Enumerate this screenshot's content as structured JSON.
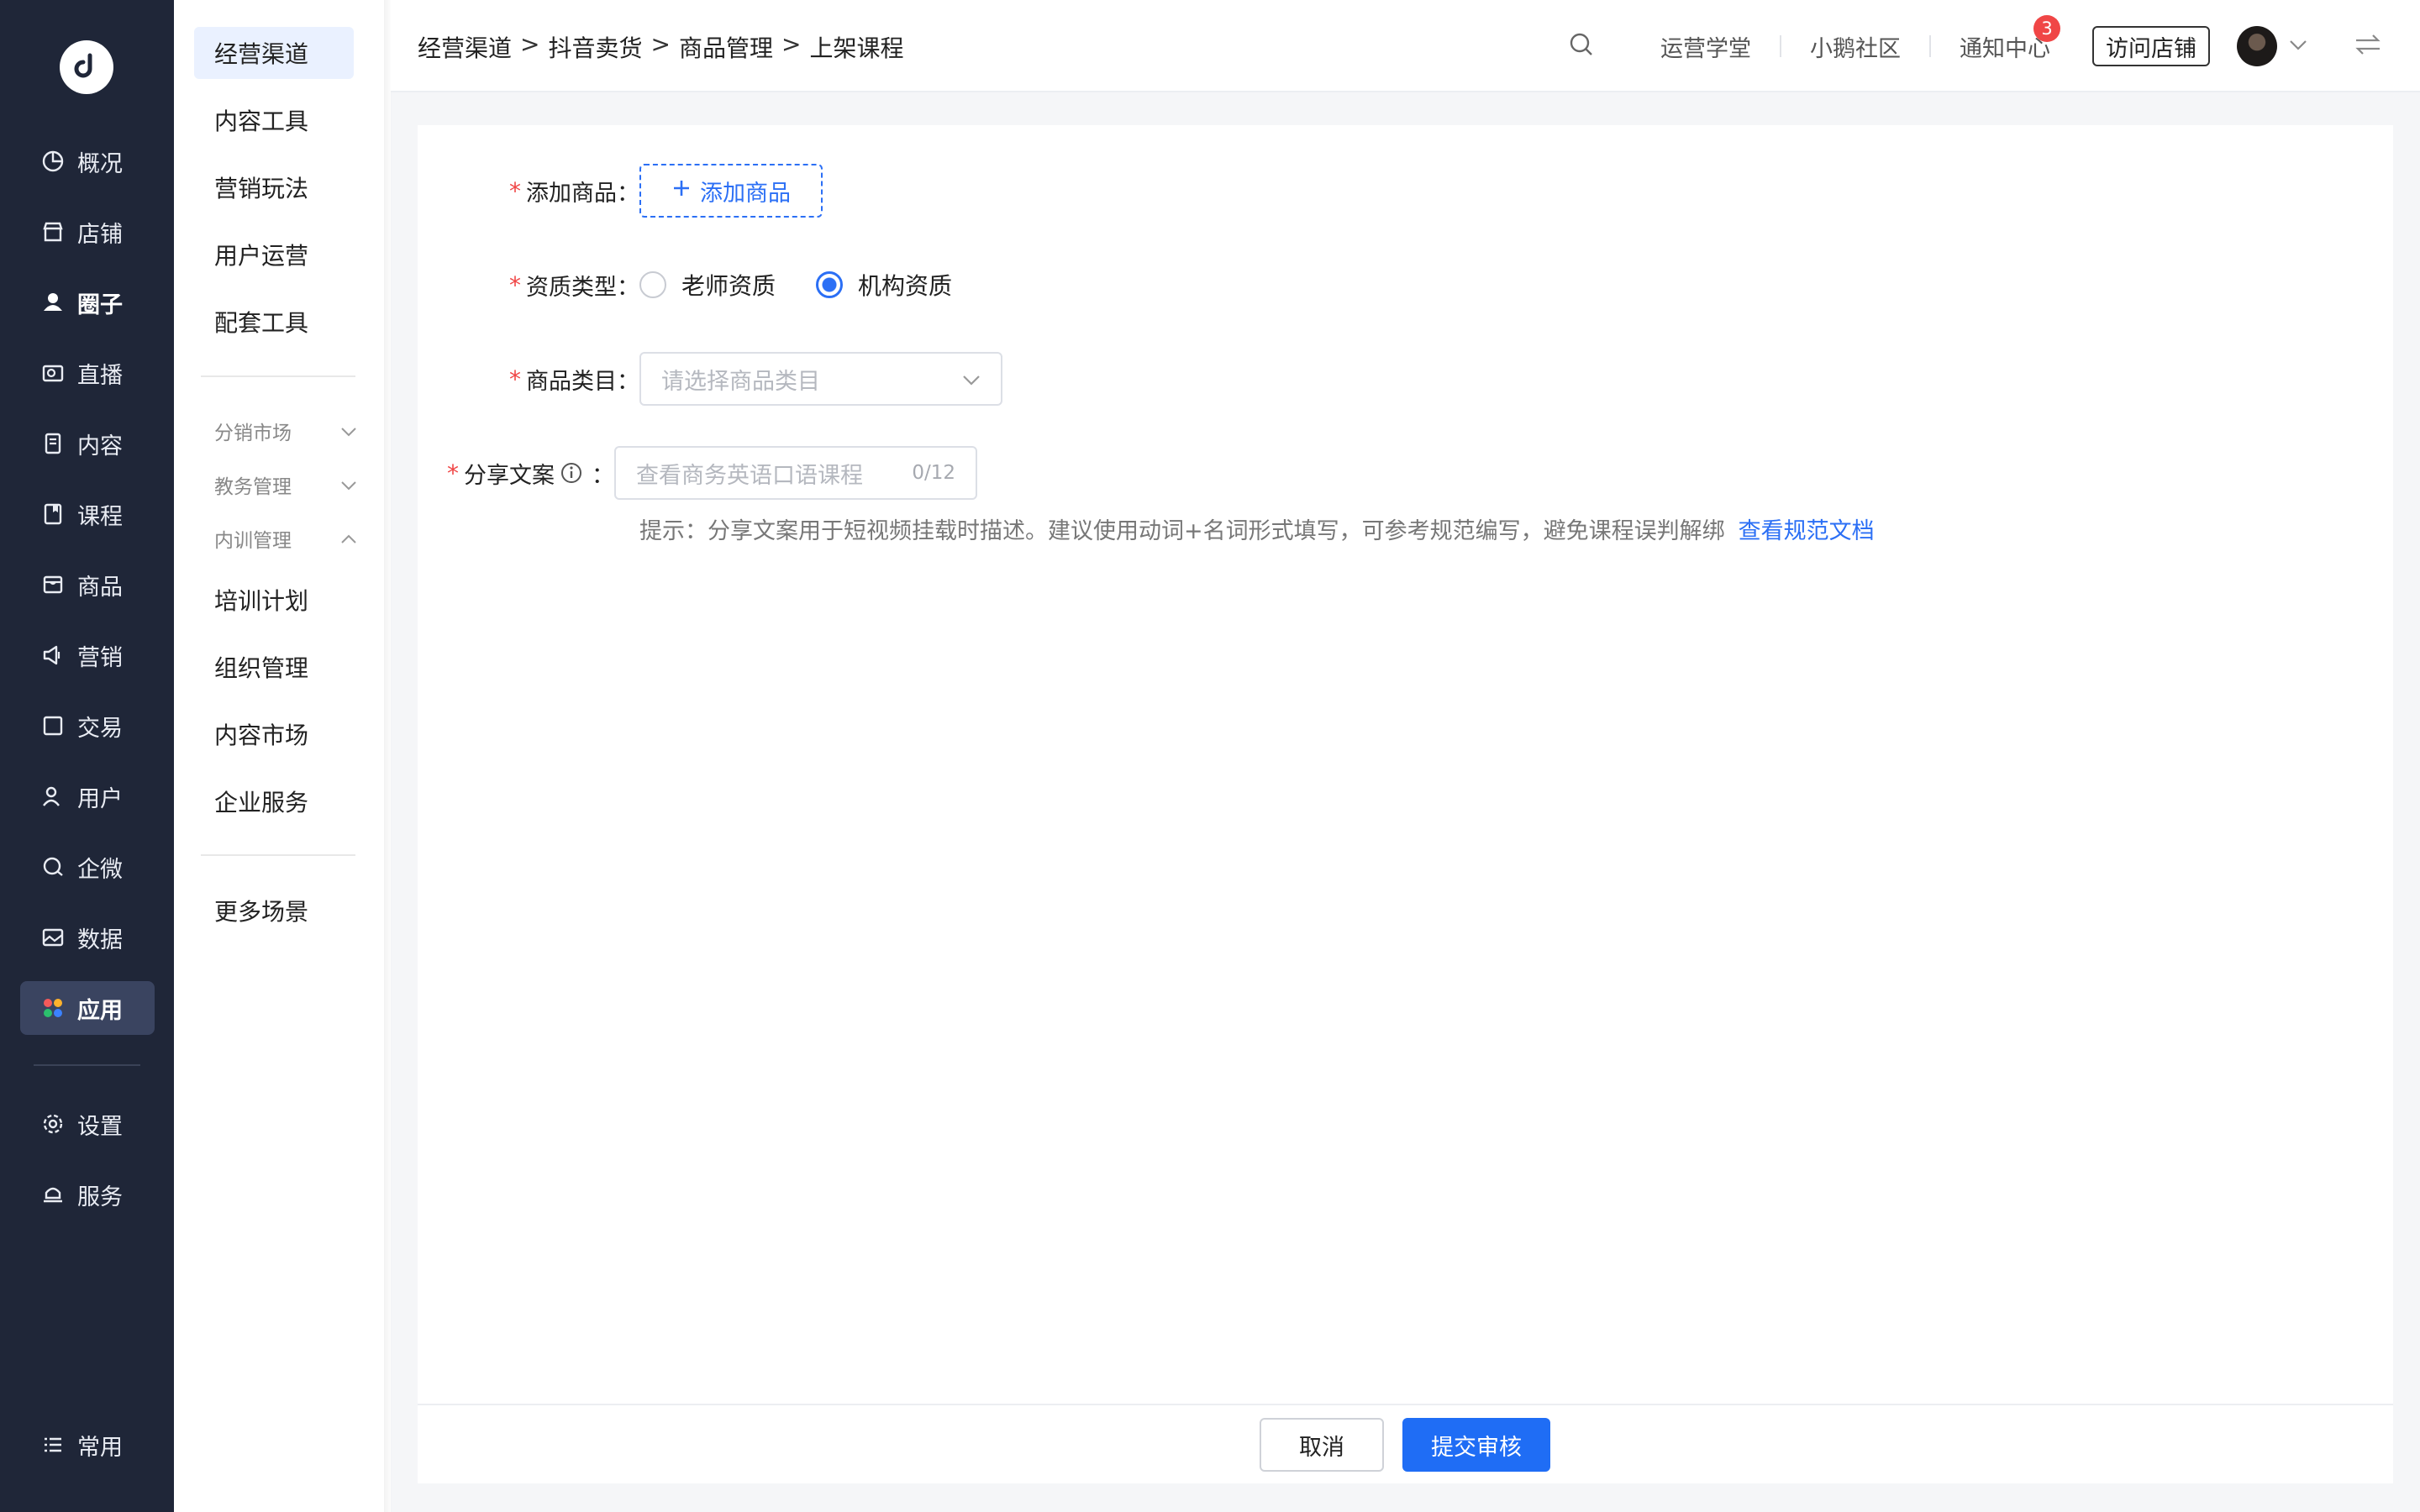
{
  "rail": {
    "items": [
      {
        "label": "概况",
        "icon": "pie-chart-icon"
      },
      {
        "label": "店铺",
        "icon": "store-icon"
      },
      {
        "label": "圈子",
        "icon": "group-icon"
      },
      {
        "label": "直播",
        "icon": "live-camera-icon"
      },
      {
        "label": "内容",
        "icon": "document-icon"
      },
      {
        "label": "课程",
        "icon": "book-icon"
      },
      {
        "label": "商品",
        "icon": "package-icon"
      },
      {
        "label": "营销",
        "icon": "megaphone-icon"
      },
      {
        "label": "交易",
        "icon": "square-icon"
      },
      {
        "label": "用户",
        "icon": "user-icon"
      },
      {
        "label": "企微",
        "icon": "chat-icon"
      },
      {
        "label": "数据",
        "icon": "image-chart-icon"
      },
      {
        "label": "应用",
        "icon": "apps-icon"
      }
    ],
    "bottom_items": [
      {
        "label": "设置",
        "icon": "gear-icon"
      },
      {
        "label": "服务",
        "icon": "service-icon"
      }
    ],
    "common_label": "常用",
    "active_index": 12
  },
  "submenu": {
    "top_items": [
      "经营渠道",
      "内容工具",
      "营销玩法",
      "用户运营",
      "配套工具"
    ],
    "groups": [
      {
        "label": "分销市场",
        "expanded": false
      },
      {
        "label": "教务管理",
        "expanded": false
      },
      {
        "label": "内训管理",
        "expanded": true
      }
    ],
    "group_items": [
      "培训计划",
      "组织管理",
      "内容市场",
      "企业服务"
    ],
    "more": "更多场景"
  },
  "header": {
    "breadcrumb": [
      "经营渠道",
      "抖音卖货",
      "商品管理",
      "上架课程"
    ],
    "breadcrumb_sep": ">",
    "links": [
      "运营学堂",
      "小鹅社区",
      "通知中心"
    ],
    "notification_count": "3",
    "visit_store": "访问店铺"
  },
  "form": {
    "add_product": {
      "label": "添加商品：",
      "button": "添加商品"
    },
    "qualification": {
      "label": "资质类型：",
      "options": [
        "老师资质",
        "机构资质"
      ],
      "selected": "机构资质"
    },
    "category": {
      "label": "商品类目：",
      "placeholder": "请选择商品类目"
    },
    "share_copy": {
      "label": "分享文案",
      "colon": "：",
      "placeholder": "查看商务英语口语课程",
      "counter": "0/12"
    },
    "hint": "提示：分享文案用于短视频挂载时描述。建议使用动词+名词形式填写，可参考规范编写，避免课程误判解绑",
    "hint_link": "查看规范文档",
    "required_mark": "*"
  },
  "footer": {
    "cancel": "取消",
    "submit": "提交审核"
  },
  "colors": {
    "rail_bg": "#1f2638",
    "primary": "#1f6df5",
    "required": "#f04646",
    "active_sub_bg": "#eaf1ff"
  }
}
